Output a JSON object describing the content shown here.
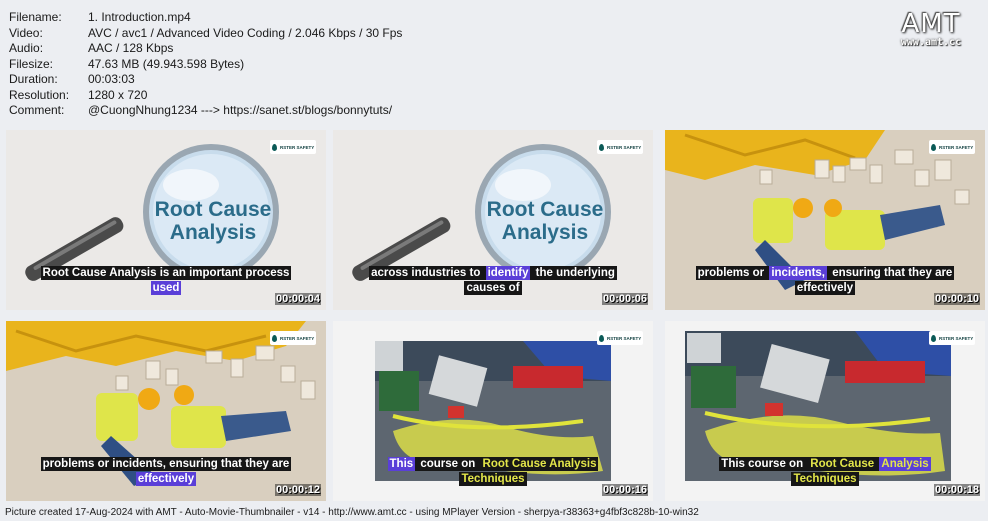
{
  "meta": [
    {
      "key": "Filename:",
      "value": "1. Introduction.mp4"
    },
    {
      "key": "Video:",
      "value": "AVC / avc1 / Advanced Video Coding / 2.046 Kbps / 30 Fps"
    },
    {
      "key": "Audio:",
      "value": "AAC / 128 Kbps"
    },
    {
      "key": "Filesize:",
      "value": "47.63 MB (49.943.598 Bytes)"
    },
    {
      "key": "Duration:",
      "value": "00:03:03"
    },
    {
      "key": "Resolution:",
      "value": "1280 x 720"
    },
    {
      "key": "Comment:",
      "value": "@CuongNhung1234 ---> https://sanet.st/blogs/bonnytuts/"
    }
  ],
  "logo": {
    "big": "AMT",
    "small": "www.amt.cc"
  },
  "brand_label": "RSTER SAFETY",
  "magnifier_text": {
    "line1": "Root Cause",
    "line2": "Analysis"
  },
  "thumbs": [
    {
      "time": "00:00:04",
      "caption": {
        "l1": "Root Cause Analysis is an important process",
        "l2": "used"
      }
    },
    {
      "time": "00:00:06",
      "caption": {
        "l1a": "across industries to ",
        "l1b": "identify",
        "l1c": " the underlying",
        "l2": "causes of"
      }
    },
    {
      "time": "00:00:10",
      "caption": {
        "l1a": "problems or ",
        "l1b": "incidents,",
        "l1c": " ensuring that they are",
        "l2": "effectively"
      }
    },
    {
      "time": "00:00:12",
      "caption": {
        "l1": "problems or incidents, ensuring that they are",
        "l2": "effectively"
      }
    },
    {
      "time": "00:00:16",
      "caption": {
        "l1a": "This",
        "l1b": " course on ",
        "l1c": "Root Cause Analysis",
        "l2": "Techniques"
      }
    },
    {
      "time": "00:00:18",
      "caption": {
        "l1a": "This course on ",
        "l1b": "Root Cause ",
        "l1c": "Analysis",
        "l2": "Techniques"
      }
    }
  ],
  "footer": "Picture created 17-Aug-2024 with AMT - Auto-Movie-Thumbnailer - v14 - http://www.amt.cc - using MPlayer Version - sherpya-r38363+g4fbf3c828b-10-win32"
}
